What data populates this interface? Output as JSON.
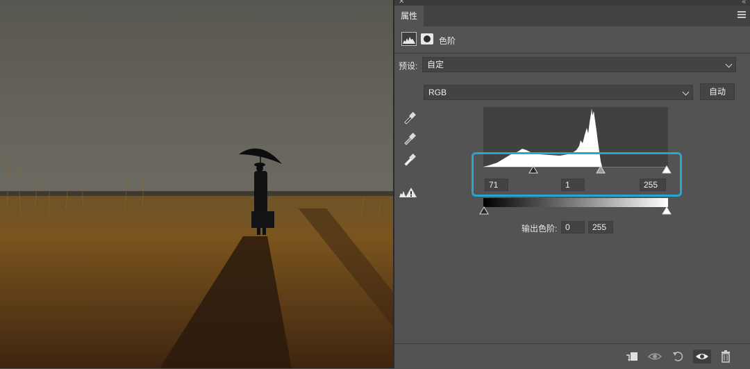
{
  "panel": {
    "tab_label": "属性",
    "adjustment_title": "色阶",
    "preset_label": "预设:",
    "preset_value": "自定",
    "channel_value": "RGB",
    "auto_button": "自动"
  },
  "input_levels": {
    "black": "71",
    "gamma": "1",
    "white": "255"
  },
  "output_levels": {
    "label": "输出色阶:",
    "black": "0",
    "white": "255"
  },
  "colors": {
    "highlight_box": "#2aa4d0",
    "panel_bg": "#535353"
  },
  "icons": {
    "window": [
      "close-icon",
      "collapse-icon",
      "panel-menu-icon"
    ],
    "header": [
      "levels-adjustment-icon",
      "layer-mask-icon"
    ],
    "tools": [
      "black-point-eyedropper-icon",
      "gray-point-eyedropper-icon",
      "white-point-eyedropper-icon",
      "clipping-warning-icon"
    ],
    "bottom": [
      "clip-to-layer-icon",
      "view-previous-state-icon",
      "reset-icon",
      "visibility-eye-icon",
      "delete-trash-icon"
    ]
  }
}
